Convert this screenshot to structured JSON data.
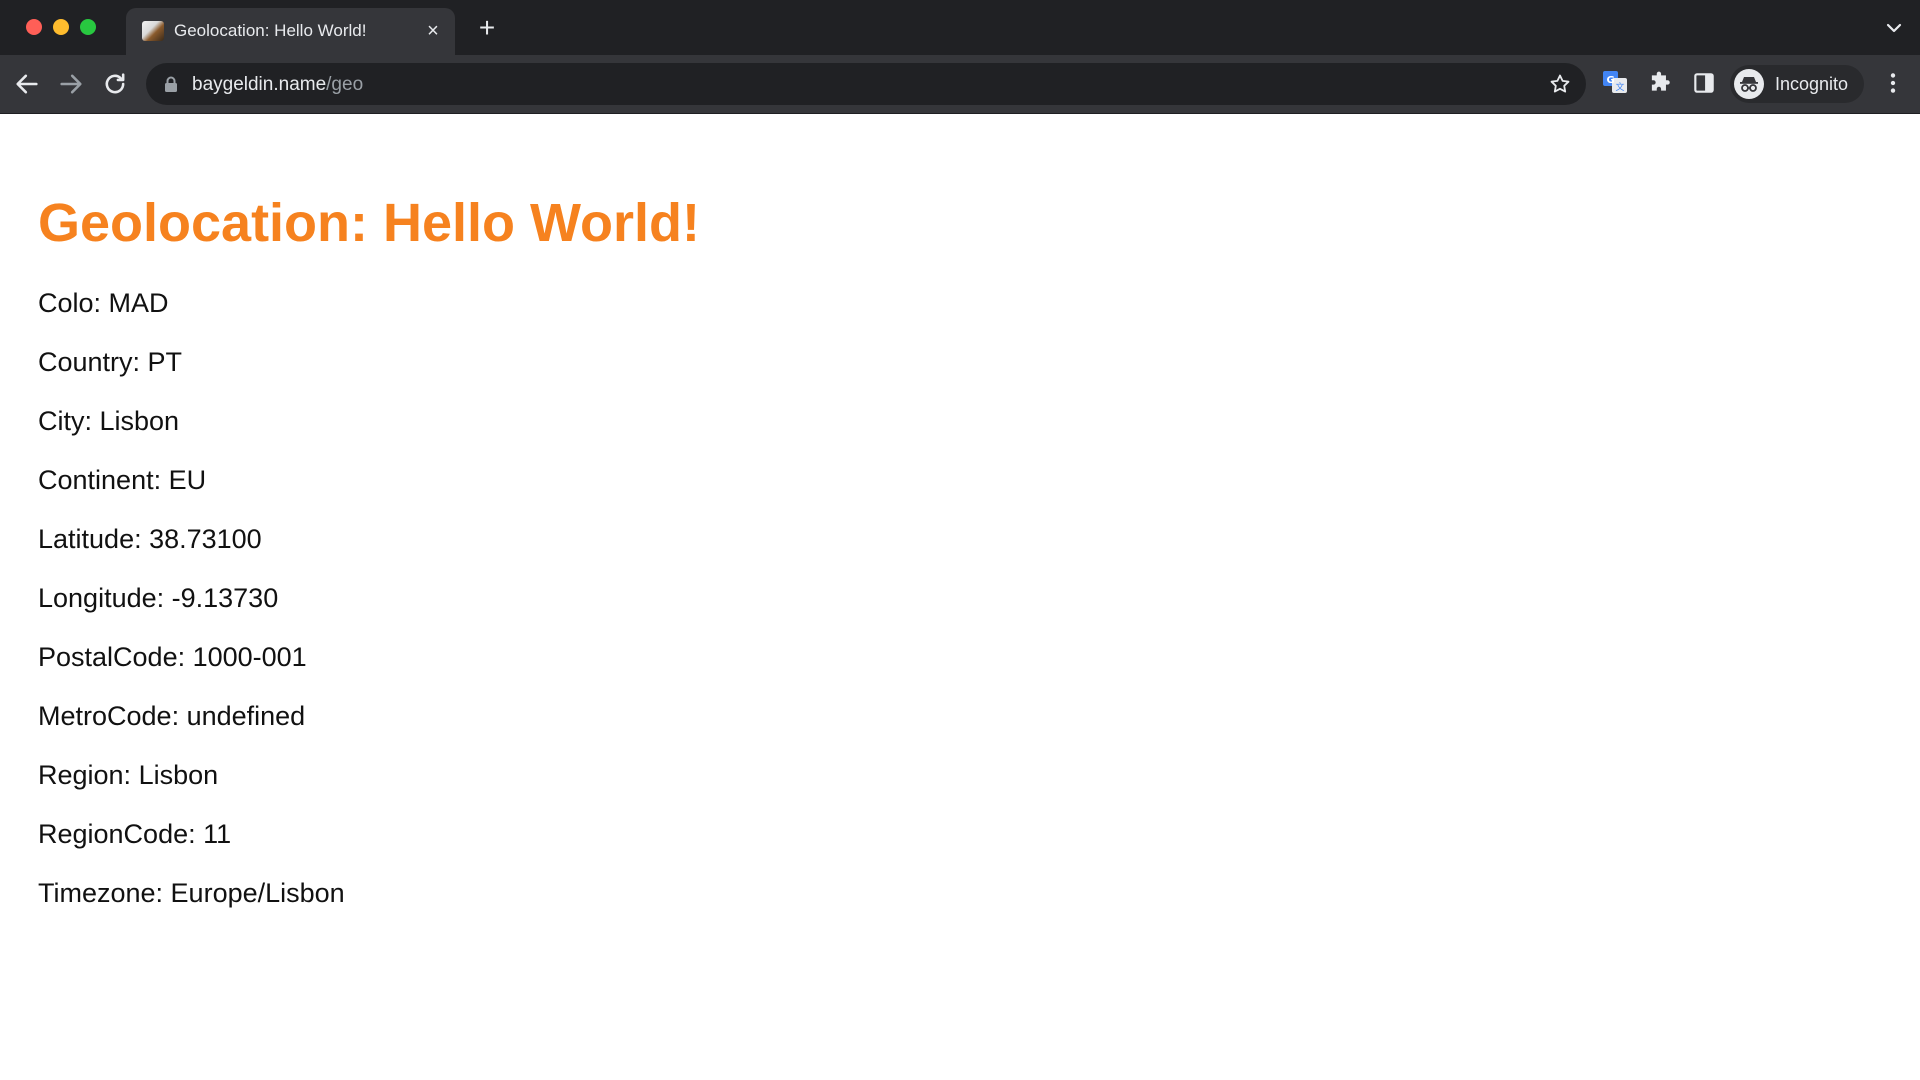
{
  "browser": {
    "tab": {
      "title": "Geolocation: Hello World!",
      "favicon": "page-favicon",
      "close_glyph": "×"
    },
    "new_tab_glyph": "+",
    "address_bar": {
      "host": "baygeldin.name",
      "path": "/geo"
    },
    "profile": {
      "label": "Incognito",
      "icon": "incognito-icon"
    },
    "icons": [
      "back-arrow-icon",
      "forward-arrow-icon",
      "reload-icon",
      "lock-icon",
      "star-icon",
      "translate-icon",
      "puzzle-extension-icon",
      "side-panel-icon",
      "kebab-menu-icon",
      "tab-search-chevron-icon"
    ],
    "colors": {
      "titlebar": "#202124",
      "toolbar": "#35363a"
    }
  },
  "page": {
    "title": "Geolocation: Hello World!",
    "title_color": "#f6821f",
    "fields": [
      "Colo: MAD",
      "Country: PT",
      "City: Lisbon",
      "Continent: EU",
      "Latitude: 38.73100",
      "Longitude: -9.13730",
      "PostalCode: 1000-001",
      "MetroCode: undefined",
      "Region: Lisbon",
      "RegionCode: 11",
      "Timezone: Europe/Lisbon"
    ]
  }
}
